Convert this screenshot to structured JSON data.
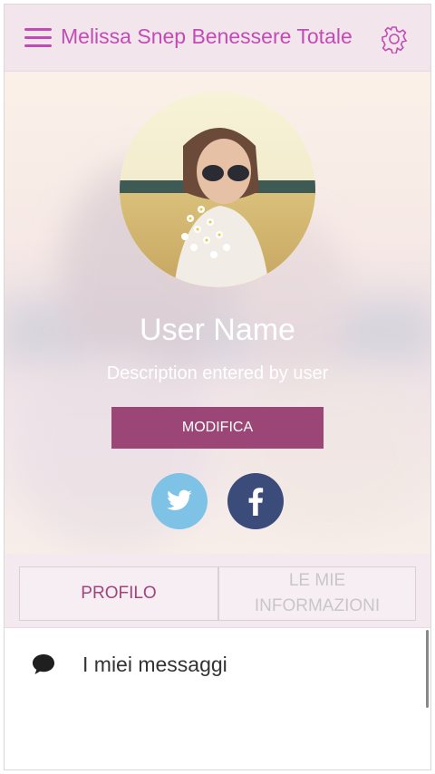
{
  "header": {
    "title": "Melissa Snep Benessere Totale",
    "menu_icon": "hamburger-menu-icon",
    "settings_icon": "gear-icon",
    "accent_color": "#c24bb6"
  },
  "profile": {
    "name": "User Name",
    "description": "Description entered by user",
    "edit_label": "MODIFICA",
    "edit_color": "#9b4677"
  },
  "social": {
    "twitter": {
      "glyph": "🐦",
      "color": "#7ec2e6"
    },
    "facebook": {
      "glyph": "f",
      "color": "#3b4b7a"
    }
  },
  "tabs": [
    {
      "label": "PROFILO"
    },
    {
      "label": "LE MIE INFORMAZIONI"
    }
  ],
  "list": [
    {
      "label": "I miei messaggi",
      "icon": "chat-bubble-icon"
    }
  ]
}
